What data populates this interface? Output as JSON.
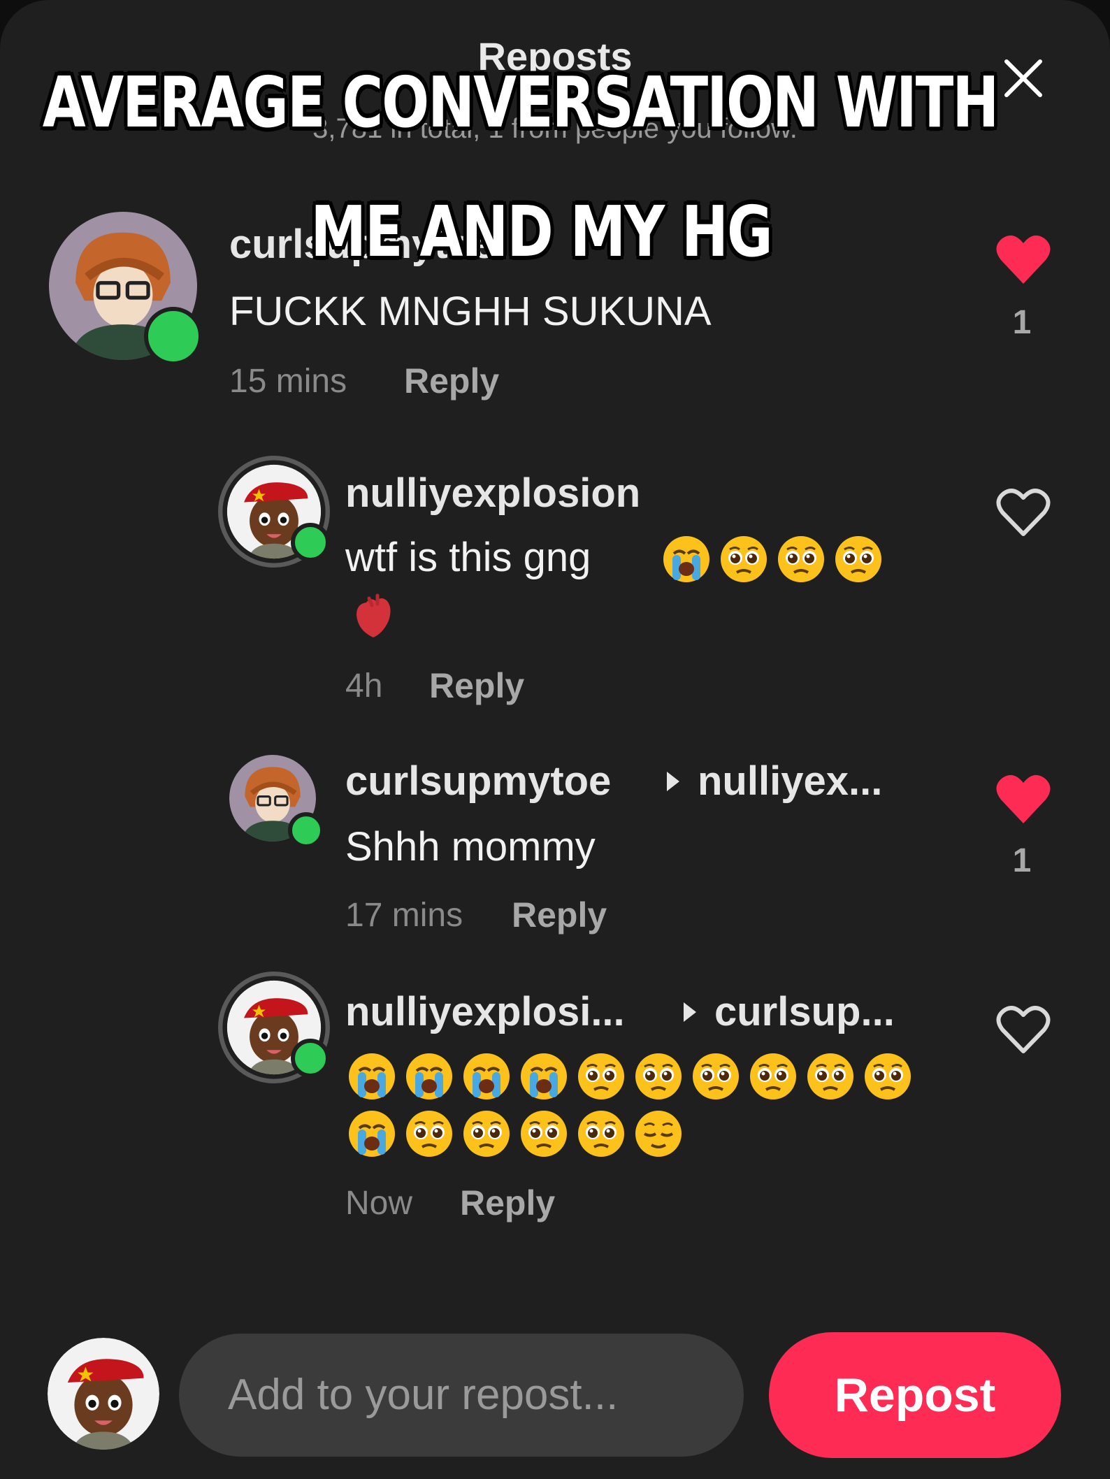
{
  "header": {
    "title": "Reposts",
    "subtitle": "3,781 in total, 1 from people you follow."
  },
  "meme": {
    "line1": "AVERAGE CONVERSATION WITH",
    "line2": "ME AND MY HG"
  },
  "comments": [
    {
      "username": "curlsupmytoe",
      "text": "FUCKK MNGHH SUKUNA",
      "time": "15 mins",
      "reply_label": "Reply",
      "liked": true,
      "like_count": "1"
    },
    {
      "username": "nulliyexplosion",
      "text": "wtf is this gng",
      "time": "4h",
      "reply_label": "Reply",
      "liked": false,
      "like_count": ""
    },
    {
      "username": "curlsupmytoe",
      "reply_to": "nulliyex...",
      "text": "Shhh mommy",
      "time": "17 mins",
      "reply_label": "Reply",
      "liked": true,
      "like_count": "1"
    },
    {
      "username": "nulliyexplosi...",
      "reply_to": "curlsup...",
      "text": "",
      "time": "Now",
      "reply_label": "Reply",
      "liked": false,
      "like_count": ""
    }
  ],
  "composer": {
    "placeholder": "Add to your repost...",
    "button_label": "Repost"
  },
  "colors": {
    "sheet_bg": "#1f1f1f",
    "accent": "#fe2c55",
    "online": "#2ecc57"
  },
  "icons": [
    "close-icon",
    "heart-filled-icon",
    "heart-outline-icon",
    "crying-emoji",
    "pleading-emoji",
    "anatomical-heart-emoji",
    "relieved-emoji"
  ]
}
